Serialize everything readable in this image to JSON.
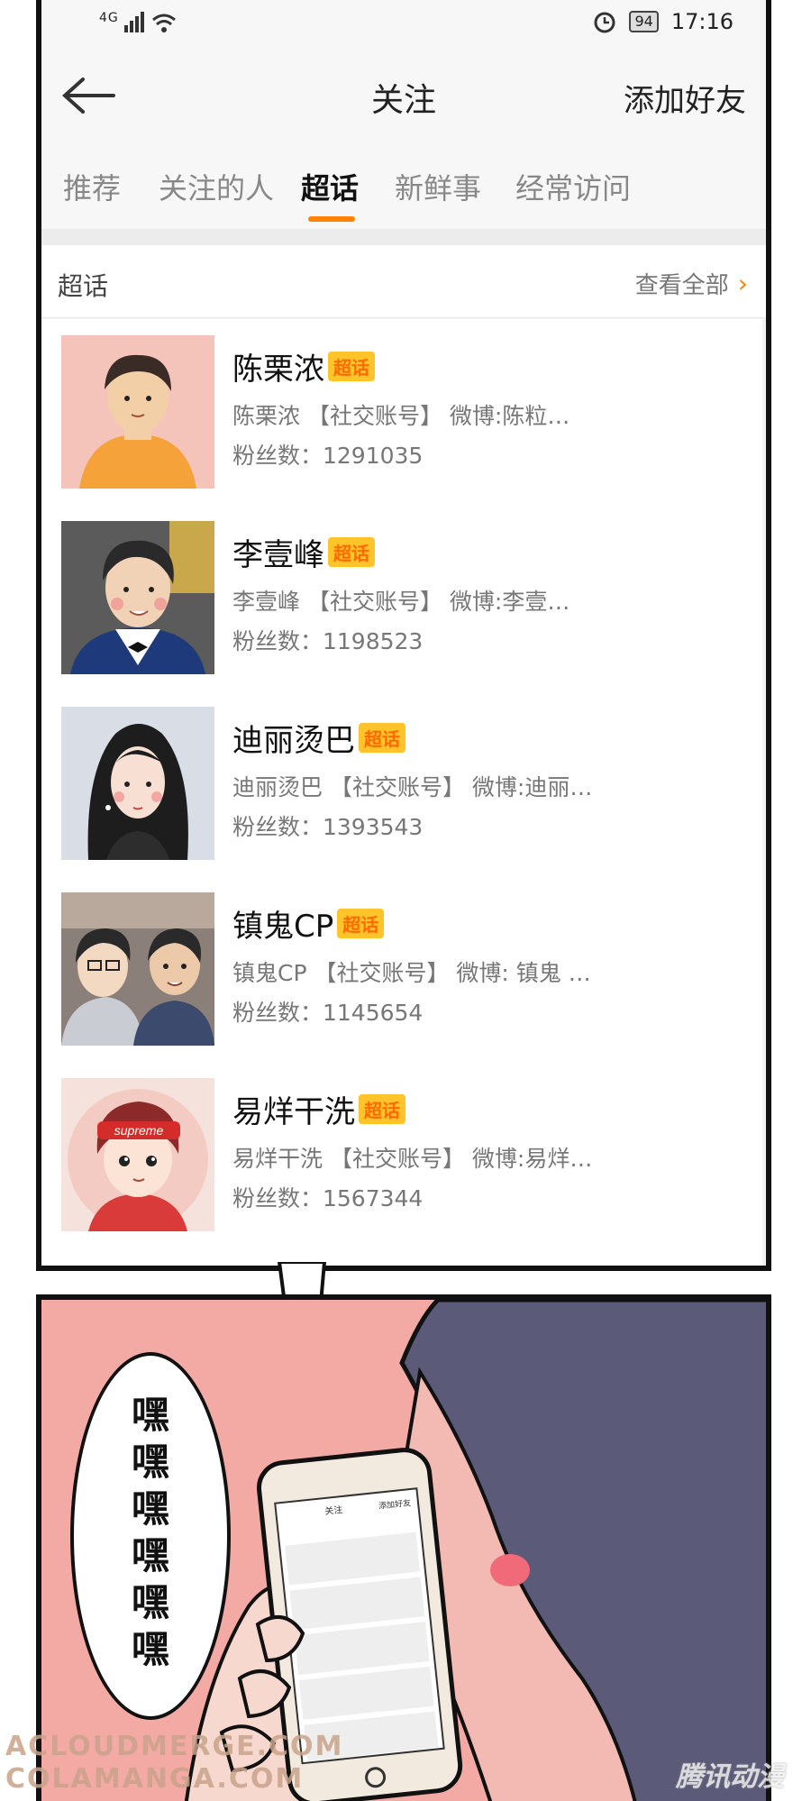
{
  "status_bar": {
    "network": "4G",
    "battery": "94",
    "time": "17:16"
  },
  "header": {
    "title": "关注",
    "add_friend": "添加好友"
  },
  "tabs": [
    {
      "label": "推荐"
    },
    {
      "label": "关注的人"
    },
    {
      "label": "超话",
      "active": true
    },
    {
      "label": "新鲜事"
    },
    {
      "label": "经常访问"
    }
  ],
  "section": {
    "title": "超话",
    "view_all": "查看全部"
  },
  "badge_label": "超话",
  "items": [
    {
      "name": "陈栗浓",
      "desc": "陈栗浓 【社交账号】 微博:陈粒…",
      "fans": "粉丝数：1291035"
    },
    {
      "name": "李壹峰",
      "desc": "李壹峰 【社交账号】 微博:李壹…",
      "fans": "粉丝数：1198523"
    },
    {
      "name": "迪丽烫巴",
      "desc": "迪丽烫巴 【社交账号】 微博:迪丽…",
      "fans": "粉丝数：1393543"
    },
    {
      "name": "镇鬼CP",
      "desc": "镇鬼CP 【社交账号】 微博: 镇鬼 …",
      "fans": "粉丝数：1145654"
    },
    {
      "name": "易烊干洗",
      "desc": "易烊干洗 【社交账号】 微博:易烊…",
      "fans": "粉丝数：1567344"
    }
  ],
  "comic": {
    "speech": [
      "嘿",
      "嘿",
      "嘿",
      "嘿",
      "嘿",
      "嘿"
    ],
    "cap_text": "supreme"
  },
  "phone_mini": {
    "title": "关注",
    "add": "添加好友"
  },
  "watermarks": {
    "line1": "ACLOUDMERGE.COM",
    "line2": "COLAMANGA.COM",
    "brand": "腾讯动漫"
  },
  "colors": {
    "accent": "#ff8200",
    "badge_bg": "#ffc42a",
    "comic_bg": "#f3a9a4",
    "hair": "#5b5a78"
  }
}
